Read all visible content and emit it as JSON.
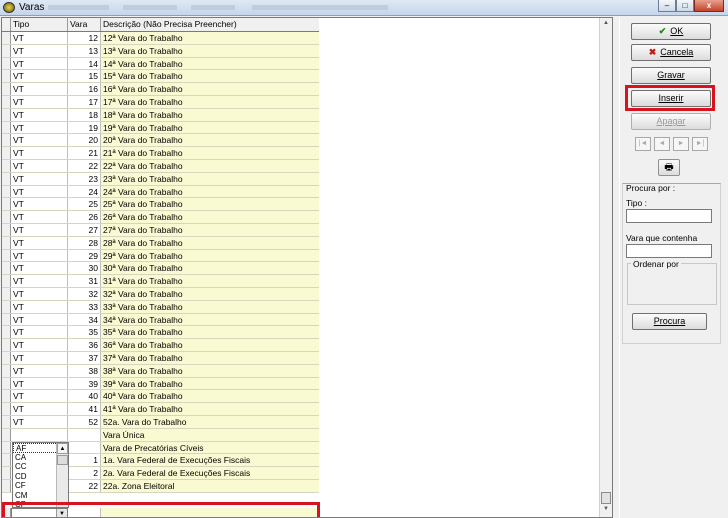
{
  "window": {
    "title": "Varas",
    "controls": {
      "minimize": "–",
      "maximize": "□",
      "close": "x"
    }
  },
  "grid": {
    "columns": [
      "Tipo",
      "Vara",
      "Descrição (Não Precisa Preencher)"
    ],
    "rows": [
      {
        "tipo": "VT",
        "vara": "12",
        "desc": "12ª Vara do Trabalho"
      },
      {
        "tipo": "VT",
        "vara": "13",
        "desc": "13ª Vara do Trabalho"
      },
      {
        "tipo": "VT",
        "vara": "14",
        "desc": "14ª Vara do Trabalho"
      },
      {
        "tipo": "VT",
        "vara": "15",
        "desc": "15ª Vara do Trabalho"
      },
      {
        "tipo": "VT",
        "vara": "16",
        "desc": "16ª Vara do Trabalho"
      },
      {
        "tipo": "VT",
        "vara": "17",
        "desc": "17ª Vara do Trabalho"
      },
      {
        "tipo": "VT",
        "vara": "18",
        "desc": "18ª Vara do Trabalho"
      },
      {
        "tipo": "VT",
        "vara": "19",
        "desc": "19ª Vara do Trabalho"
      },
      {
        "tipo": "VT",
        "vara": "20",
        "desc": "20ª Vara do Trabalho"
      },
      {
        "tipo": "VT",
        "vara": "21",
        "desc": "21ª Vara do Trabalho"
      },
      {
        "tipo": "VT",
        "vara": "22",
        "desc": "22ª Vara do Trabalho"
      },
      {
        "tipo": "VT",
        "vara": "23",
        "desc": "23ª Vara do Trabalho"
      },
      {
        "tipo": "VT",
        "vara": "24",
        "desc": "24ª Vara do Trabalho"
      },
      {
        "tipo": "VT",
        "vara": "25",
        "desc": "25ª Vara do Trabalho"
      },
      {
        "tipo": "VT",
        "vara": "26",
        "desc": "26ª Vara do Trabalho"
      },
      {
        "tipo": "VT",
        "vara": "27",
        "desc": "27ª Vara do Trabalho"
      },
      {
        "tipo": "VT",
        "vara": "28",
        "desc": "28ª Vara do Trabalho"
      },
      {
        "tipo": "VT",
        "vara": "29",
        "desc": "29ª Vara do Trabalho"
      },
      {
        "tipo": "VT",
        "vara": "30",
        "desc": "30ª Vara do Trabalho"
      },
      {
        "tipo": "VT",
        "vara": "31",
        "desc": "31ª Vara do Trabalho"
      },
      {
        "tipo": "VT",
        "vara": "32",
        "desc": "32ª Vara do Trabalho"
      },
      {
        "tipo": "VT",
        "vara": "33",
        "desc": "33ª Vara do Trabalho"
      },
      {
        "tipo": "VT",
        "vara": "34",
        "desc": "34ª Vara do Trabalho"
      },
      {
        "tipo": "VT",
        "vara": "35",
        "desc": "35ª Vara do Trabalho"
      },
      {
        "tipo": "VT",
        "vara": "36",
        "desc": "36ª Vara do Trabalho"
      },
      {
        "tipo": "VT",
        "vara": "37",
        "desc": "37ª Vara do Trabalho"
      },
      {
        "tipo": "VT",
        "vara": "38",
        "desc": "38ª Vara do Trabalho"
      },
      {
        "tipo": "VT",
        "vara": "39",
        "desc": "39ª Vara do Trabalho"
      },
      {
        "tipo": "VT",
        "vara": "40",
        "desc": "40ª Vara do Trabalho"
      },
      {
        "tipo": "VT",
        "vara": "41",
        "desc": "41ª Vara do Trabalho"
      },
      {
        "tipo": "VT",
        "vara": "52",
        "desc": "52a. Vara do Trabalho"
      },
      {
        "tipo": "",
        "vara": "",
        "desc": "Vara Única"
      },
      {
        "tipo": "",
        "vara": "",
        "desc": "Vara de Precatórias Cíveis"
      },
      {
        "tipo": "",
        "vara": "1",
        "desc": "1a. Vara Federal de Execuções Fiscais"
      },
      {
        "tipo": "",
        "vara": "2",
        "desc": "2a. Vara Federal de Execuções Fiscais"
      },
      {
        "tipo": "",
        "vara": "22",
        "desc": "22a. Zona Eleitoral"
      }
    ],
    "tipo_dropdown_options": [
      "AF",
      "CA",
      "CC",
      "CD",
      "CF",
      "CM",
      "CP"
    ]
  },
  "sidebar": {
    "ok_label": "OK",
    "cancel_label": "Cancela",
    "save_label": "Gravar",
    "insert_label": "Inserir",
    "delete_label": "Apagar",
    "nav_first": "|◄",
    "nav_prev": "◄",
    "nav_next": "►",
    "nav_last": "►|",
    "print_icon": "🖶",
    "search_title": "Procura por :",
    "tipo_label": "Tipo :",
    "vara_label": "Vara que contenha",
    "order_label": "Ordenar por",
    "search_button": "Procura"
  }
}
